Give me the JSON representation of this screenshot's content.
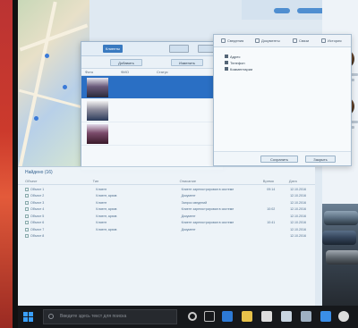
{
  "list_window": {
    "tabs": [
      "Клиенты",
      "Архив"
    ],
    "toolbar_buttons": [
      "Добавить",
      "Изменить"
    ],
    "columns": [
      "Фото",
      "ФИО",
      "Статус"
    ]
  },
  "detail_window": {
    "tabs": [
      "Сведения",
      "Документы",
      "Связи",
      "История"
    ],
    "items": [
      "Адрес",
      "Телефон",
      "Комментарии"
    ],
    "footer_buttons": [
      "Сохранить",
      "Закрыть"
    ]
  },
  "results_window": {
    "title": "Найдено (16)",
    "columns": [
      "Объект",
      "Тип",
      "Описание",
      "Время",
      "Дата"
    ],
    "rows": [
      {
        "name": "Объект 1",
        "type": "Клиент",
        "desc": "Клиент зарегистрирован в системе",
        "time": "09:14",
        "date": "12.10.2016"
      },
      {
        "name": "Объект 2",
        "type": "Клиент, архив",
        "desc": "Документ",
        "time": "",
        "date": "12.10.2016"
      },
      {
        "name": "Объект 3",
        "type": "Клиент",
        "desc": "Запрос сведений",
        "time": "",
        "date": "12.10.2016"
      },
      {
        "name": "Объект 4",
        "type": "Клиент, архив",
        "desc": "Клиент зарегистрирован в системе",
        "time": "10:02",
        "date": "12.10.2016"
      },
      {
        "name": "Объект 5",
        "type": "Клиент, архив",
        "desc": "Документ",
        "time": "",
        "date": "12.10.2016"
      },
      {
        "name": "Объект 6",
        "type": "Клиент",
        "desc": "Клиент зарегистрирован в системе",
        "time": "10:41",
        "date": "12.10.2016"
      },
      {
        "name": "Объект 7",
        "type": "Клиент, архив",
        "desc": "Документ",
        "time": "",
        "date": "12.10.2016"
      },
      {
        "name": "Объект 8",
        "type": "",
        "desc": "",
        "time": "",
        "date": "12.10.2016"
      }
    ]
  },
  "taskbar": {
    "search_placeholder": "Введите здесь текст для поиска"
  },
  "colors": {
    "accent": "#2a6fc4",
    "taskbar": "#16181b",
    "window_bg": "#f4f8fb"
  }
}
